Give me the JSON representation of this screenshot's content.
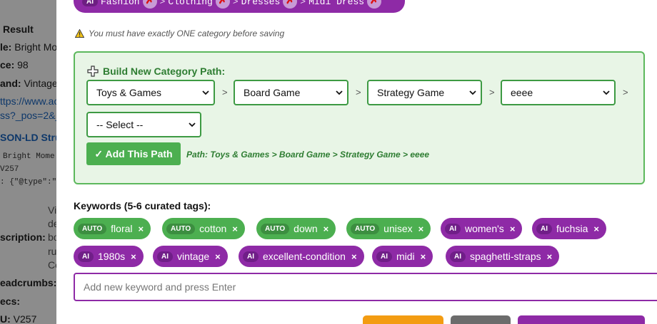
{
  "background": {
    "result_heading": "Result",
    "title_row": {
      "label": "le:",
      "value": "Bright Mo"
    },
    "price_row": {
      "label": "ce:",
      "value": "98"
    },
    "brand_row": {
      "label": "and:",
      "value": "Vintage"
    },
    "url_line1": "ttps://www.ac",
    "url_line2": "ss?_pos=2&_",
    "jsonld_heading": "SON-LD Stru",
    "mono_line1": "Bright Mome",
    "mono_line2": "V257",
    "mono_line3": ": {\"@type\":\"",
    "desc_lines": [
      "Vi",
      "de",
      "bo",
      "ru",
      "Co"
    ],
    "description_label": "scription:",
    "breadcrumbs_label": "eadcrumbs:",
    "specs_label": "ecs:",
    "sku_row": {
      "label": "U:",
      "value": "V257"
    }
  },
  "modal": {
    "current_path": {
      "badge": "AI",
      "segments": [
        "Fashion",
        "Clothing",
        "Dresses",
        "Midi Dress"
      ],
      "separator": ">"
    },
    "warning": "You must have exactly ONE category before saving",
    "build": {
      "title": "Build New Category Path:",
      "selects": [
        "Toys & Games",
        "Board Game",
        "Strategy Game",
        "eeee",
        "-- Select --"
      ],
      "separator": ">",
      "add_button": "✓ Add This Path",
      "path_text": "Path: Toys & Games > Board Game > Strategy Game > eeee"
    },
    "keywords": {
      "label": "Keywords (5-6 curated tags):",
      "remove_glyph": "×",
      "chips": [
        {
          "tag": "AUTO",
          "text": "floral",
          "kind": "auto"
        },
        {
          "tag": "AUTO",
          "text": "cotton",
          "kind": "auto"
        },
        {
          "tag": "AUTO",
          "text": "down",
          "kind": "auto"
        },
        {
          "tag": "AUTO",
          "text": "unisex",
          "kind": "auto"
        },
        {
          "tag": "AI",
          "text": "women's",
          "kind": "ai"
        },
        {
          "tag": "AI",
          "text": "fuchsia",
          "kind": "ai"
        },
        {
          "tag": "AI",
          "text": "1980s",
          "kind": "ai"
        },
        {
          "tag": "AI",
          "text": "vintage",
          "kind": "ai"
        },
        {
          "tag": "AI",
          "text": "excellent-condition",
          "kind": "ai"
        },
        {
          "tag": "AI",
          "text": "midi",
          "kind": "ai"
        },
        {
          "tag": "AI",
          "text": "spaghetti-straps",
          "kind": "ai"
        }
      ],
      "input_placeholder": "Add new keyword and press Enter"
    },
    "colors": {
      "purple": "#8e2aa6",
      "green": "#4caf50",
      "orange": "#f39c12",
      "gray": "#6c6c6c"
    }
  }
}
